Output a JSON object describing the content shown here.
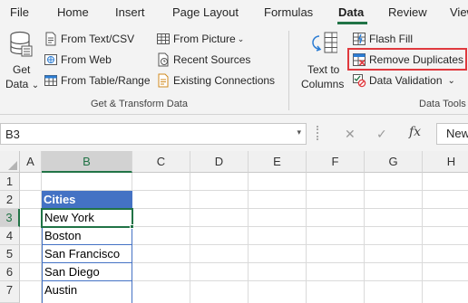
{
  "ribbon_tabs": [
    "File",
    "Home",
    "Insert",
    "Page Layout",
    "Formulas",
    "Data",
    "Review",
    "View"
  ],
  "active_tab": "Data",
  "get_transform": {
    "get_data_line1": "Get",
    "get_data_line2": "Data",
    "get_data_caret": "⌄",
    "from_text_csv": "From Text/CSV",
    "from_web": "From Web",
    "from_table_range": "From Table/Range",
    "from_picture": "From Picture",
    "from_picture_caret": "⌄",
    "recent_sources": "Recent Sources",
    "existing_connections": "Existing Connections",
    "group_label": "Get & Transform Data"
  },
  "data_tools": {
    "text_to_columns_line1": "Text to",
    "text_to_columns_line2": "Columns",
    "flash_fill": "Flash Fill",
    "remove_duplicates": "Remove Duplicates",
    "data_validation": "Data Validation",
    "data_validation_caret": "⌄",
    "group_label": "Data Tools"
  },
  "formula_bar": {
    "name_box": "B3",
    "name_box_caret": "▾",
    "cancel_symbol": "✕",
    "enter_symbol": "✓",
    "fx_symbol": "fx",
    "formula_value": "New"
  },
  "columns": [
    "A",
    "B",
    "C",
    "D",
    "E",
    "F",
    "G",
    "H"
  ],
  "rows": [
    "1",
    "2",
    "3",
    "4",
    "5",
    "6",
    "7"
  ],
  "table": {
    "header": "Cities",
    "cities": [
      "New York",
      "Boston",
      "San Francisco",
      "San Diego",
      "Austin"
    ]
  },
  "colors": {
    "accent_green": "#217346",
    "table_header_blue": "#4472c4",
    "highlight_red": "#e0393e"
  }
}
